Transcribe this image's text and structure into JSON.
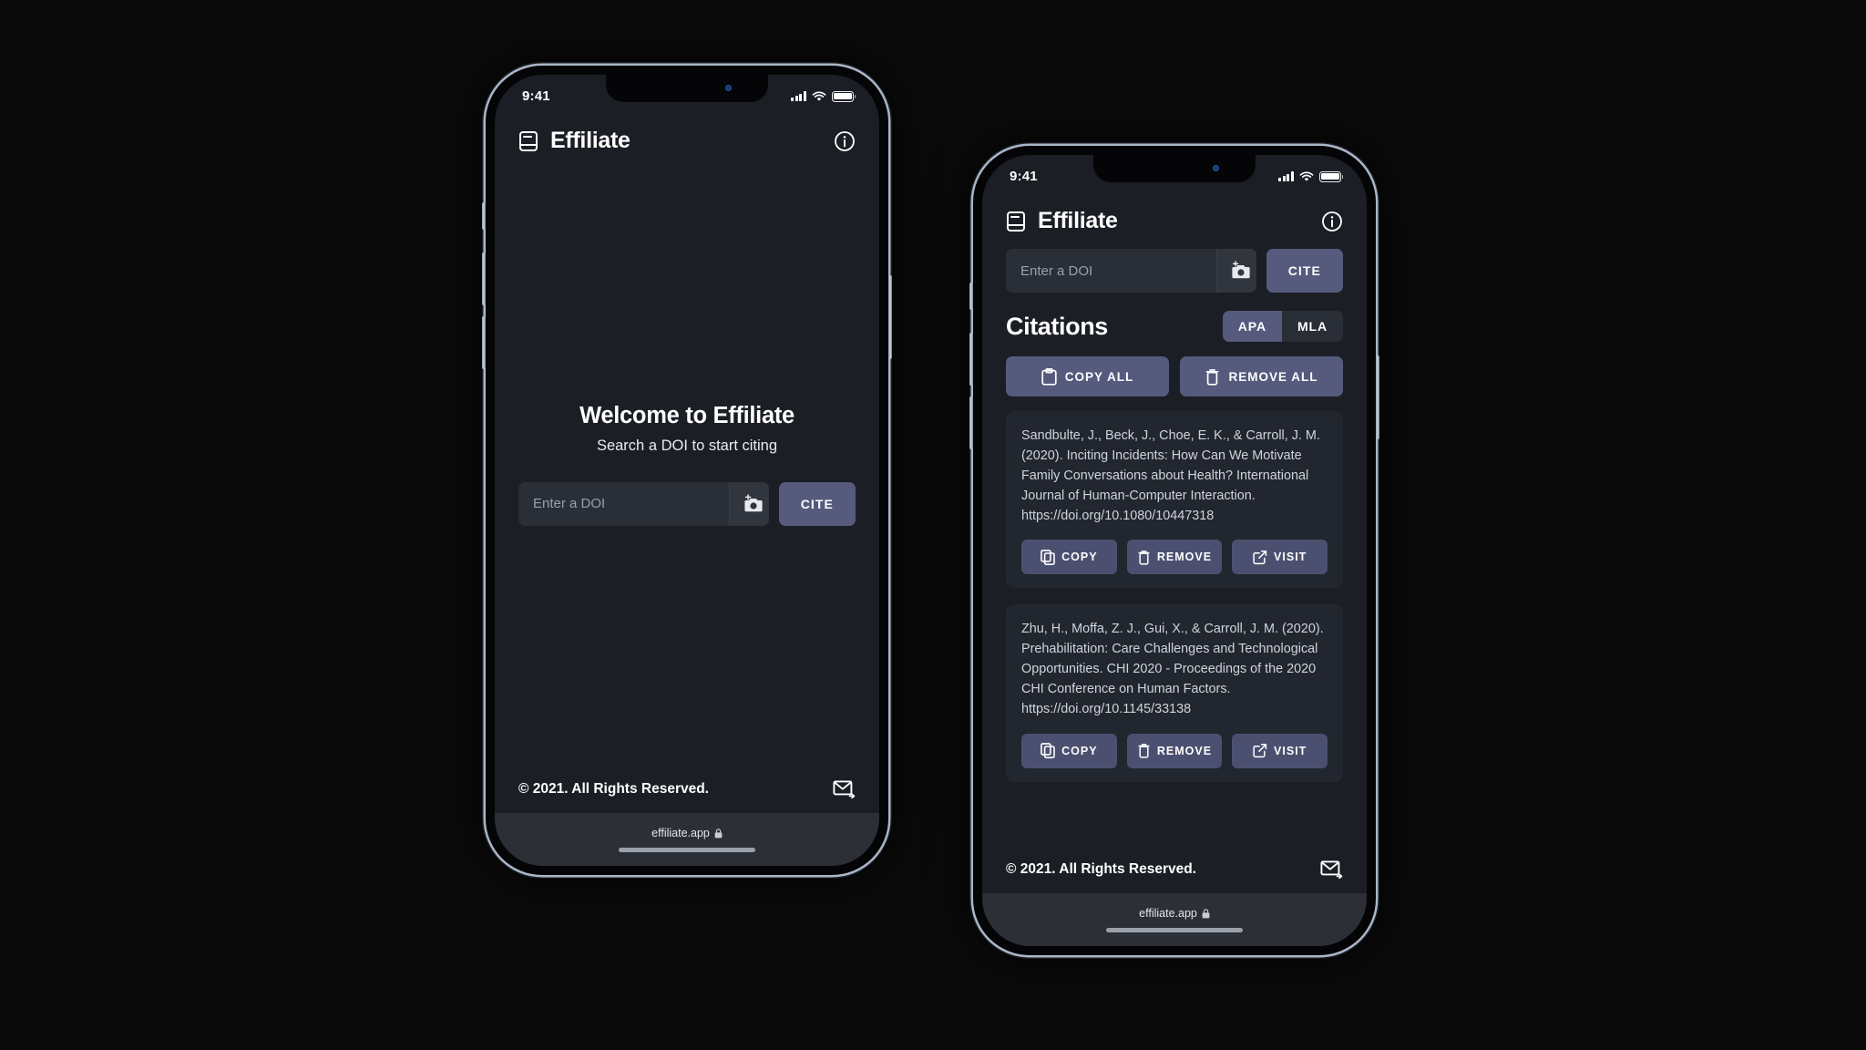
{
  "accent": "#565a7d",
  "accent_dark": "#4c5070",
  "card_bg": "#22262e",
  "screen_bg": "#1b1e24",
  "phones": [
    {
      "id": "phone-welcome",
      "statusbar": {
        "time": "9:41",
        "signal_icon": "cellular-bars-icon",
        "wifi_icon": "wifi-icon",
        "battery_icon": "battery-icon"
      },
      "appbar": {
        "logo_icon": "book-icon",
        "title": "Effiliate",
        "info_icon": "info-circle-icon"
      },
      "welcome": {
        "title": "Welcome to Effiliate",
        "subtitle": "Search a  DOI to start citing"
      },
      "search": {
        "placeholder": "Enter a DOI",
        "value": "",
        "camera_icon": "camera-add-icon",
        "cite_label": "CITE"
      },
      "footer": {
        "copyright": "© 2021. All Rights Reserved.",
        "mail_icon": "mail-forward-icon"
      },
      "browser": {
        "url": "effiliate.app",
        "lock_icon": "lock-icon"
      }
    },
    {
      "id": "phone-citations",
      "statusbar": {
        "time": "9:41",
        "signal_icon": "cellular-bars-icon",
        "wifi_icon": "wifi-icon",
        "battery_icon": "battery-icon"
      },
      "appbar": {
        "logo_icon": "book-icon",
        "title": "Effiliate",
        "info_icon": "info-circle-icon"
      },
      "search": {
        "placeholder": "Enter a DOI",
        "value": "",
        "camera_icon": "camera-add-icon",
        "cite_label": "CITE"
      },
      "section": {
        "title": "Citations",
        "styles": [
          {
            "label": "APA",
            "selected": true
          },
          {
            "label": "MLA",
            "selected": false
          }
        ]
      },
      "bulk_actions": [
        {
          "label": "COPY ALL",
          "icon": "clipboard-icon"
        },
        {
          "label": "REMOVE ALL",
          "icon": "trash-icon"
        }
      ],
      "citations": [
        {
          "text": "Sandbulte, J., Beck, J., Choe, E. K., & Carroll, J. M. (2020). Inciting Incidents: How Can We Motivate Family Conversations about Health? International Journal of Human-Computer Interaction. https://doi.org/10.1080/10447318",
          "actions": [
            {
              "label": "COPY",
              "icon": "copy-icon"
            },
            {
              "label": "REMOVE",
              "icon": "trash-icon"
            },
            {
              "label": "VISIT",
              "icon": "external-link-icon"
            }
          ]
        },
        {
          "text": "Zhu, H., Moffa, Z. J., Gui, X., & Carroll, J. M. (2020). Prehabilitation: Care Challenges and Technological Opportunities. CHI 2020 - Proceedings of the 2020 CHI Conference on Human Factors. https://doi.org/10.1145/33138",
          "actions": [
            {
              "label": "COPY",
              "icon": "copy-icon"
            },
            {
              "label": "REMOVE",
              "icon": "trash-icon"
            },
            {
              "label": "VISIT",
              "icon": "external-link-icon"
            }
          ]
        }
      ],
      "footer": {
        "copyright": "© 2021. All Rights Reserved.",
        "mail_icon": "mail-forward-icon"
      },
      "browser": {
        "url": "effiliate.app",
        "lock_icon": "lock-icon"
      }
    }
  ]
}
